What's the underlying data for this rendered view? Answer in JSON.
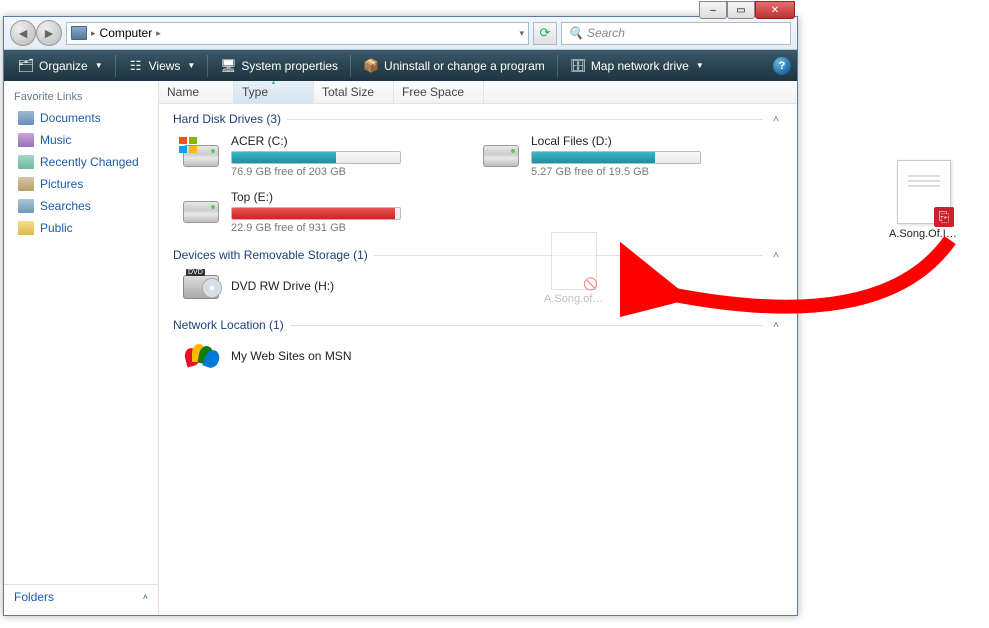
{
  "window": {
    "breadcrumb": {
      "root": "Computer"
    },
    "search_placeholder": "Search",
    "title_buttons": {
      "min": "–",
      "max": "▭",
      "close": "✕"
    }
  },
  "toolbar": {
    "organize": "Organize",
    "views": "Views",
    "sysprops": "System properties",
    "uninstall": "Uninstall or change a program",
    "mapdrive": "Map network drive"
  },
  "sidebar": {
    "header": "Favorite Links",
    "items": [
      {
        "label": "Documents",
        "icon": "doc"
      },
      {
        "label": "Music",
        "icon": "music"
      },
      {
        "label": "Recently Changed",
        "icon": "recent"
      },
      {
        "label": "Pictures",
        "icon": "pic"
      },
      {
        "label": "Searches",
        "icon": "srch"
      },
      {
        "label": "Public",
        "icon": "pub"
      }
    ],
    "folders": "Folders"
  },
  "columns": {
    "name": "Name",
    "type": "Type",
    "totalsize": "Total Size",
    "freespace": "Free Space"
  },
  "groups": {
    "hdd": {
      "title": "Hard Disk Drives (3)",
      "items": [
        {
          "name": "ACER (C:)",
          "free": "76.9 GB free of 203 GB",
          "pct": 62,
          "color": "teal",
          "winlogo": true
        },
        {
          "name": "Local Files (D:)",
          "free": "5.27 GB free of 19.5 GB",
          "pct": 73,
          "color": "teal"
        },
        {
          "name": "Top (E:)",
          "free": "22.9 GB free of 931 GB",
          "pct": 97,
          "color": "red"
        }
      ]
    },
    "removable": {
      "title": "Devices with Removable Storage (1)",
      "items": [
        {
          "name": "DVD RW Drive (H:)"
        }
      ]
    },
    "network": {
      "title": "Network Location (1)",
      "items": [
        {
          "name": "My Web Sites on MSN"
        }
      ]
    }
  },
  "ghost_file": "A.Song.of.Ic...",
  "desktop_file": "A.Song.Of.Ic..."
}
